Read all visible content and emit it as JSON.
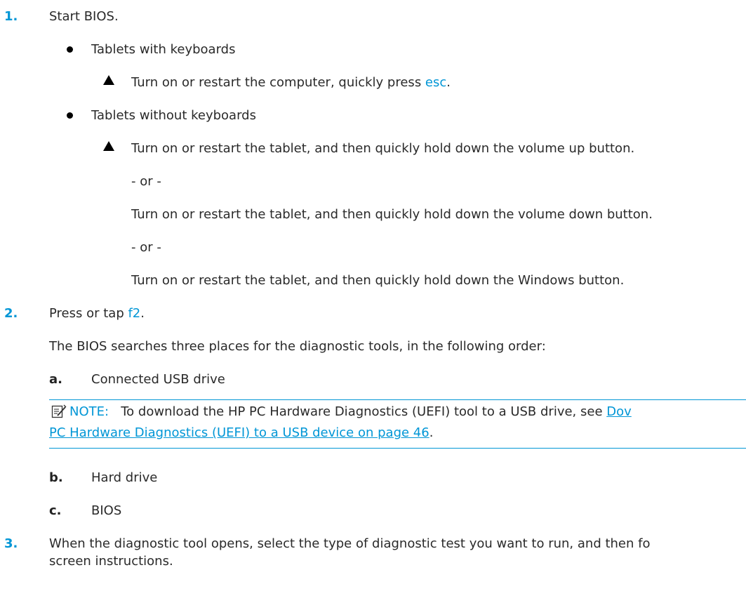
{
  "steps": [
    {
      "number": "1.",
      "text": "Start BIOS."
    },
    {
      "number": "2.",
      "text_before": "Press or tap ",
      "key": "f2",
      "text_after": "."
    },
    {
      "number": "3.",
      "line1": "When the diagnostic tool opens, select the type of diagnostic test you want to run, and then fo",
      "line2": "screen instructions."
    }
  ],
  "bios_options": [
    {
      "title": "Tablets with keyboards",
      "action_before": "Turn on or restart the computer, quickly press ",
      "action_key": "esc",
      "action_after": "."
    },
    {
      "title": "Tablets without keyboards",
      "actions": [
        "Turn on or restart the tablet, and then quickly hold down the volume up button.",
        "Turn on or restart the tablet, and then quickly hold down the volume down button.",
        "Turn on or restart the tablet, and then quickly hold down the Windows button."
      ],
      "separator": "- or -"
    }
  ],
  "search_intro": "The BIOS searches three places for the diagnostic tools, in the following order:",
  "search_places": [
    {
      "letter": "a.",
      "text": "Connected USB drive"
    },
    {
      "letter": "b.",
      "text": "Hard drive"
    },
    {
      "letter": "c.",
      "text": "BIOS"
    }
  ],
  "note": {
    "label": "NOTE:",
    "text": "To download the HP PC Hardware Diagnostics (UEFI) tool to a USB drive, see ",
    "link_line1": "Dov",
    "link_line2": "PC Hardware Diagnostics (UEFI) to a USB device on page 46",
    "trailing": ".",
    "icon": "note-pencil-icon"
  },
  "colors": {
    "accent": "#0096d6",
    "text": "#2a2a2a"
  }
}
